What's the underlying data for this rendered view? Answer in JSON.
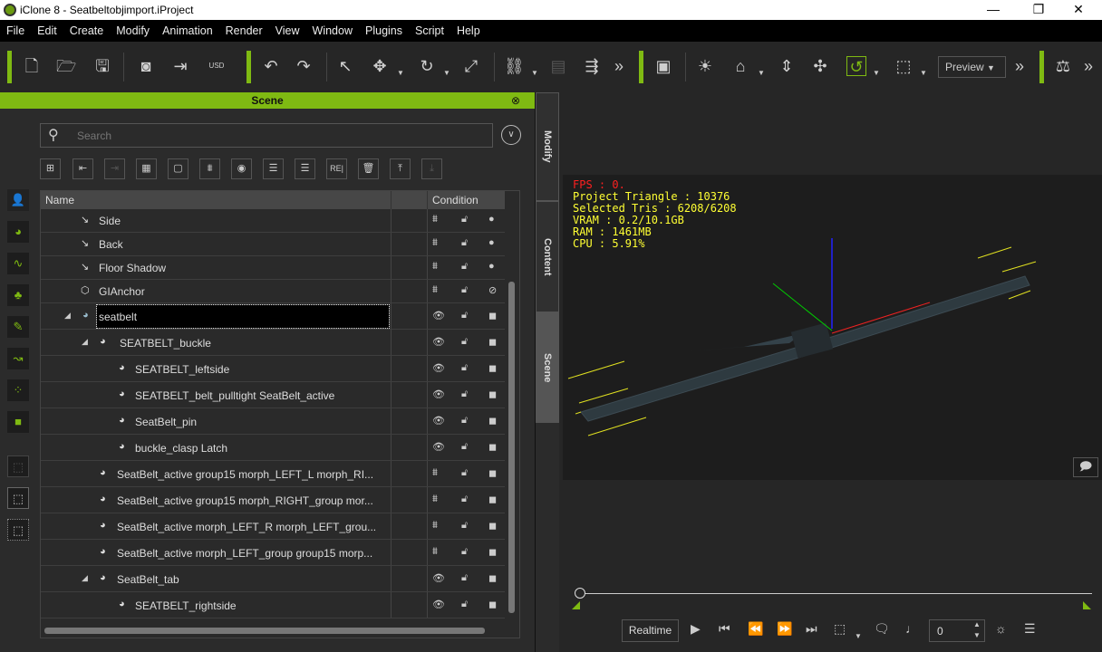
{
  "window": {
    "title": "iClone 8 - Seatbeltobjimport.iProject",
    "minimize": "—",
    "maximize": "❐",
    "close": "✕"
  },
  "menu": [
    "File",
    "Edit",
    "Create",
    "Modify",
    "Animation",
    "Render",
    "View",
    "Window",
    "Plugins",
    "Script",
    "Help"
  ],
  "toolbar": {
    "preview_label": "Preview",
    "more": "»",
    "usd": "USD"
  },
  "scene": {
    "title": "Scene",
    "search_placeholder": "Search",
    "columns": {
      "name": "Name",
      "condition": "Condition"
    },
    "rows": [
      {
        "name": "Side",
        "level": 0,
        "icon": "light",
        "vis": "hidden",
        "lock": "unlocked",
        "state": "dot"
      },
      {
        "name": "Back",
        "level": 0,
        "icon": "light",
        "vis": "hidden",
        "lock": "unlocked",
        "state": "dot"
      },
      {
        "name": "Floor Shadow",
        "level": 0,
        "icon": "light",
        "vis": "hidden",
        "lock": "unlocked",
        "state": "dot"
      },
      {
        "name": "GIAnchor",
        "level": 0,
        "icon": "cube",
        "vis": "hidden",
        "lock": "unlocked",
        "state": "none"
      },
      {
        "name": "seatbelt",
        "level": 0,
        "icon": "prop",
        "expand": true,
        "selected": true,
        "vis": "visible",
        "lock": "unlocked",
        "state": "cube"
      },
      {
        "name": "SEATBELT_buckle",
        "level": 1,
        "icon": "prop",
        "expand": true,
        "vis": "visible",
        "lock": "unlocked",
        "state": "cube"
      },
      {
        "name": "SEATBELT_leftside",
        "level": 2,
        "icon": "prop",
        "vis": "visible",
        "lock": "unlocked",
        "state": "cube"
      },
      {
        "name": "SEATBELT_belt_pulltight SeatBelt_active",
        "level": 2,
        "icon": "prop",
        "vis": "visible",
        "lock": "unlocked",
        "state": "cube"
      },
      {
        "name": "SeatBelt_pin",
        "level": 2,
        "icon": "prop",
        "vis": "visible",
        "lock": "unlocked",
        "state": "cube"
      },
      {
        "name": "buckle_clasp Latch",
        "level": 2,
        "icon": "prop",
        "vis": "visible",
        "lock": "unlocked",
        "state": "cube"
      },
      {
        "name": "SeatBelt_active group15 morph_LEFT_L morph_RI...",
        "level": 1,
        "icon": "prop",
        "vis": "hidden",
        "lock": "unlocked",
        "state": "cube"
      },
      {
        "name": "SeatBelt_active group15 morph_RIGHT_group mor...",
        "level": 1,
        "icon": "prop",
        "vis": "hidden",
        "lock": "unlocked",
        "state": "cube"
      },
      {
        "name": "SeatBelt_active morph_LEFT_R morph_LEFT_grou...",
        "level": 1,
        "icon": "prop",
        "vis": "hidden",
        "lock": "unlocked",
        "state": "cube"
      },
      {
        "name": "SeatBelt_active morph_LEFT_group group15 morp...",
        "level": 1,
        "icon": "prop",
        "vis": "hidden",
        "lock": "unlocked",
        "state": "cube"
      },
      {
        "name": "SeatBelt_tab",
        "level": 1,
        "icon": "prop",
        "expand": true,
        "vis": "visible",
        "lock": "unlocked",
        "state": "cube"
      },
      {
        "name": "SEATBELT_rightside",
        "level": 2,
        "icon": "prop",
        "vis": "visible",
        "lock": "unlocked",
        "state": "cube"
      }
    ]
  },
  "side_tabs": [
    "Modify",
    "Content",
    "Scene"
  ],
  "viewport_stats": {
    "fps": "FPS : 0.",
    "triangles": "Project Triangle : 10376",
    "selected": "Selected Tris : 6208/6208",
    "vram": "VRAM : 0.2/10.1GB",
    "ram": "RAM : 1461MB",
    "cpu": "CPU : 5.91%"
  },
  "playback": {
    "realtime_label": "Realtime",
    "frame": "0"
  },
  "colors": {
    "accent": "#7fba12",
    "fps": "#ff2020",
    "stats": "#ffff33"
  }
}
